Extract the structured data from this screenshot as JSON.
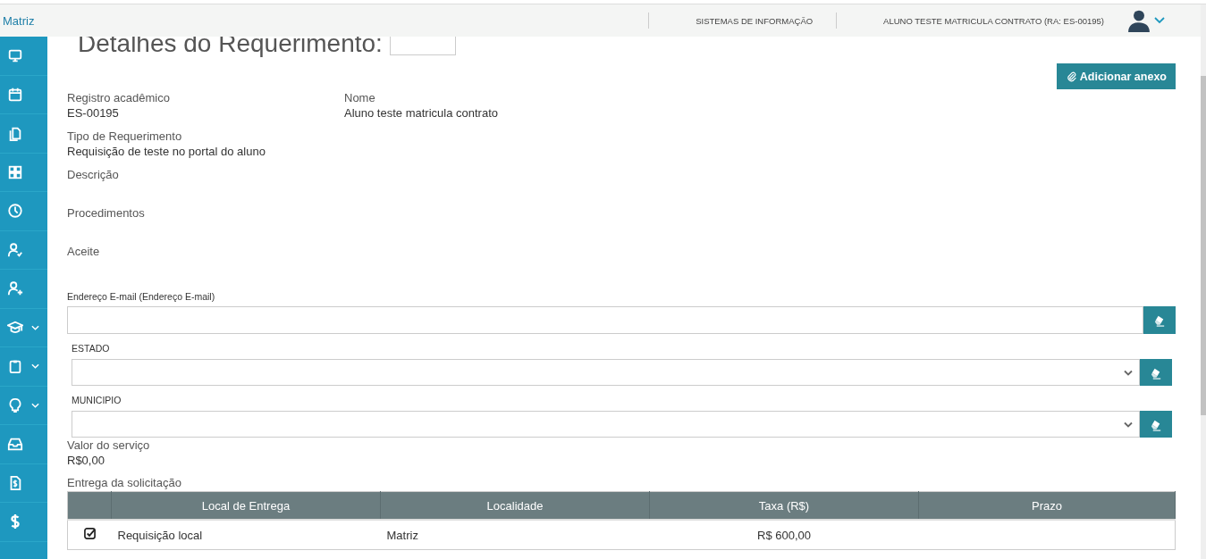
{
  "header": {
    "brand": "Matriz",
    "system": "SISTEMAS DE INFORMAÇÃO",
    "user": "ALUNO TESTE MATRICULA CONTRATO (RA: ES-00195)"
  },
  "sidebar": {
    "items": [
      {
        "submenu": false
      },
      {
        "submenu": false
      },
      {
        "submenu": false
      },
      {
        "submenu": false
      },
      {
        "submenu": false
      },
      {
        "submenu": false
      },
      {
        "submenu": false
      },
      {
        "submenu": true
      },
      {
        "submenu": true
      },
      {
        "submenu": true
      },
      {
        "submenu": false
      },
      {
        "submenu": false
      },
      {
        "submenu": false
      }
    ]
  },
  "page_title": "Detalhes do Requerimento:",
  "attach_button": "Adicionar anexo",
  "info": [
    {
      "label": "Registro acadêmico",
      "value": "ES-00195"
    },
    {
      "label": "Nome",
      "value": "Aluno teste matricula contrato"
    },
    {
      "label": "Tipo de Requerimento",
      "value": "Requisição de teste no portal do aluno"
    },
    {
      "label": "Descrição"
    },
    {
      "label": "Procedimentos"
    },
    {
      "label": "Aceite"
    }
  ],
  "fields": [
    {
      "kind": "input",
      "label": "Endereço E-mail (Endereço E-mail)"
    },
    {
      "kind": "select",
      "label": "ESTADO"
    },
    {
      "kind": "select",
      "label": "MUNICIPIO"
    }
  ],
  "service_value": {
    "label": "Valor do serviço",
    "value": "R$0,00"
  },
  "delivery": {
    "label": "Entrega da solicitação",
    "columns": [
      "Local de Entrega",
      "Localidade",
      "Taxa (R$)",
      "Prazo"
    ],
    "rows": [
      {
        "checked": true,
        "cells": [
          "Requisição local",
          "Matriz",
          "R$ 600,00"
        ]
      }
    ]
  }
}
